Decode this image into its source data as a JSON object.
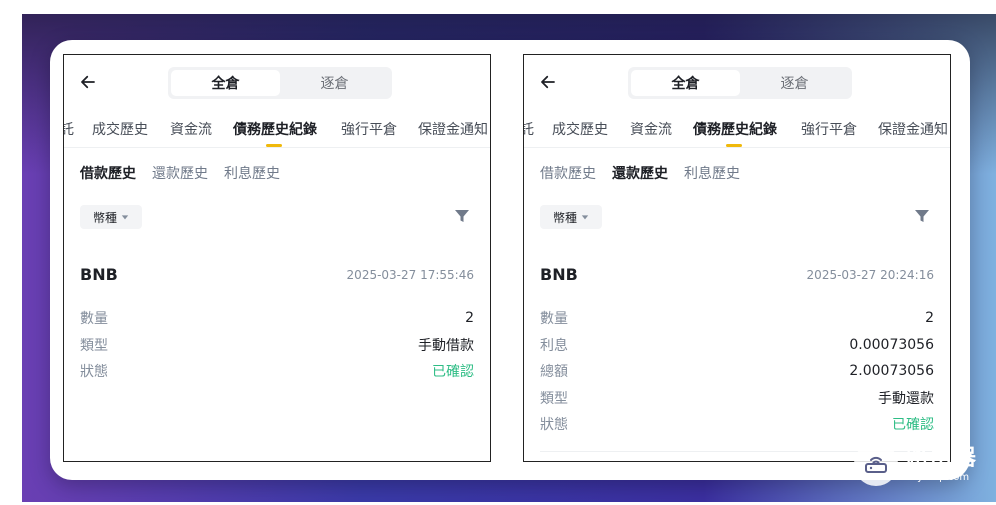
{
  "left": {
    "segments": [
      "全倉",
      "逐倉"
    ],
    "active_segment": 0,
    "tabs": [
      "託",
      "成交歷史",
      "資金流",
      "債務歷史紀錄",
      "強行平倉",
      "保證金通知"
    ],
    "subtabs": [
      "借款歷史",
      "還款歷史",
      "利息歷史"
    ],
    "active_subtab": 0,
    "filter_label": "幣種",
    "asset": "BNB",
    "time": "2025-03-27 17:55:46",
    "rows": [
      {
        "k": "數量",
        "v": "2"
      },
      {
        "k": "類型",
        "v": "手動借款"
      },
      {
        "k": "狀態",
        "v": "已確認"
      }
    ]
  },
  "right": {
    "segments": [
      "全倉",
      "逐倉"
    ],
    "active_segment": 0,
    "tabs": [
      "託",
      "成交歷史",
      "資金流",
      "債務歷史紀錄",
      "強行平倉",
      "保證金通知"
    ],
    "subtabs": [
      "借款歷史",
      "還款歷史",
      "利息歷史"
    ],
    "active_subtab": 1,
    "filter_label": "幣種",
    "asset": "BNB",
    "time": "2025-03-27 20:24:16",
    "rows": [
      {
        "k": "數量",
        "v": "2"
      },
      {
        "k": "利息",
        "v": "0.00073056"
      },
      {
        "k": "總額",
        "v": "2.00073056"
      },
      {
        "k": "類型",
        "v": "手動還款"
      },
      {
        "k": "狀態",
        "v": "已確認"
      }
    ]
  },
  "watermark": {
    "title": "路由器",
    "url": "luyouqi.com"
  },
  "colors": {
    "accent": "#f0b90b",
    "confirmed": "#2ebd85"
  },
  "icons": {
    "back": "arrow-left-icon",
    "caret": "caret-down-icon",
    "filter": "funnel-icon",
    "logo": "router-logo-icon"
  }
}
